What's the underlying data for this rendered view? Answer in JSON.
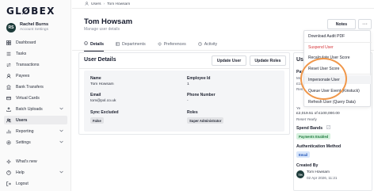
{
  "brand": {
    "logo": "GLØBEX"
  },
  "user": {
    "initials": "RS",
    "name": "Rachel Burns",
    "subtitle": "Account Settings"
  },
  "sidebar": {
    "items": [
      {
        "label": "Dashboard",
        "icon": "dashboard-icon"
      },
      {
        "label": "Tasks",
        "icon": "tasks-icon"
      },
      {
        "label": "Transactions",
        "icon": "transactions-icon"
      },
      {
        "label": "Payees",
        "icon": "payees-icon"
      },
      {
        "label": "Bank Transfers",
        "icon": "bank-transfers-icon"
      },
      {
        "label": "Virtual Cards",
        "icon": "card-icon"
      },
      {
        "label": "Batch Uploads",
        "icon": "upload-icon"
      },
      {
        "label": "Users",
        "icon": "users-icon"
      },
      {
        "label": "Reporting",
        "icon": "reporting-icon"
      },
      {
        "label": "Settings",
        "icon": "settings-icon"
      }
    ],
    "bottom": [
      {
        "label": "What's new",
        "icon": "sparkle-icon"
      },
      {
        "label": "Help",
        "icon": "help-icon"
      },
      {
        "label": "Logout",
        "icon": "logout-icon"
      }
    ]
  },
  "breadcrumb": {
    "root": "Users",
    "current": "Tom Howsam"
  },
  "page": {
    "title": "Tom Howsam",
    "subtitle": "Manage user details"
  },
  "header_actions": {
    "notes": "Notes",
    "more": "···"
  },
  "tabs": [
    {
      "label": "Details"
    },
    {
      "label": "Departments"
    },
    {
      "label": "Preferences"
    },
    {
      "label": "Activity"
    }
  ],
  "user_details": {
    "heading": "User Details",
    "update_user": "Update User",
    "update_roles": "Update Roles",
    "name_label": "Name",
    "name_value": "Tom Howsam",
    "email_label": "Email",
    "email_value": "tom@pxl.co.uk",
    "sync_label": "Sync Excluded",
    "sync_value": "False",
    "employee_id_label": "Employee Id",
    "employee_id_value": "1",
    "phone_label": "Phone Number",
    "phone_value": "-",
    "roles_label": "Roles",
    "roles_value": "Super Administrator"
  },
  "right_panel": {
    "user_label": "Use",
    "pay_label": "Pay",
    "pay_line1": "Mo",
    "pay_line2": "£10",
    "pay_line3": "Res",
    "pay_line4": "Ye",
    "pay_line5": "£2,019.51 of £100,000.00",
    "pay_line6": "Reset Yearly",
    "spend_bands_label": "Spend Bands",
    "spend_bands_value": "Payments Enabled",
    "auth_label": "Authentication Method",
    "auth_value": "Email",
    "created_label": "Created By",
    "created_initials": "TH",
    "created_name": "Tom Howsam",
    "created_date": "02 Apr 2026, 11:21"
  },
  "dropdown": {
    "items": [
      {
        "label": "Download Audit PDF"
      },
      {
        "label": "Suspend User"
      },
      {
        "label": "Recalculate User Score"
      },
      {
        "label": "Reset User Score"
      },
      {
        "label": "Impersonate User"
      },
      {
        "label": "Queue User Event (Kinstuck)"
      },
      {
        "label": "Refresh User (Query Data)"
      }
    ]
  },
  "colors": {
    "accent_ring": "#f0974a",
    "danger": "#d6373b",
    "success": "#1e7a3c"
  }
}
